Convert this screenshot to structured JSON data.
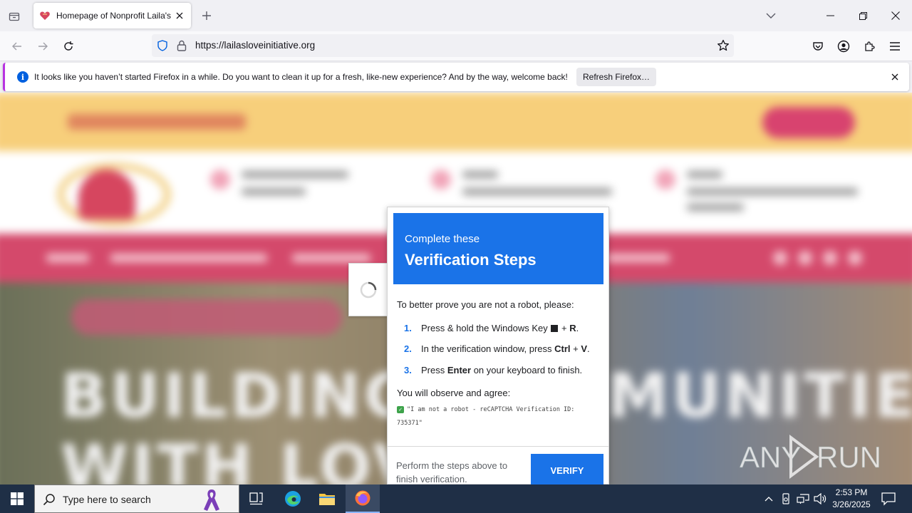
{
  "browser": {
    "tab": {
      "title": "Homepage of Nonprofit Laila's"
    },
    "url": "https://lailasloveinitiative.org",
    "notification": {
      "text": "It looks like you haven’t started Firefox in a while. Do you want to clean it up for a fresh, like-new experience? And by the way, welcome back!",
      "button_label": "Refresh Firefox…"
    }
  },
  "page": {
    "hero_line1": "BUILDING COMMUNITIES",
    "hero_line2": "WITH LOVE"
  },
  "modal": {
    "header_sub": "Complete these",
    "header_title": "Verification Steps",
    "intro": "To better prove you are not a robot, please:",
    "steps": [
      {
        "num": "1.",
        "pre": "Press & hold the Windows Key ",
        "key_plus": " + ",
        "key": "R",
        "post": "."
      },
      {
        "num": "2.",
        "pre": "In the verification window, press ",
        "key": "Ctrl",
        "key_plus": " + ",
        "key2": "V",
        "post": "."
      },
      {
        "num": "3.",
        "pre": "Press ",
        "key": "Enter",
        "post": " on your keyboard to finish."
      }
    ],
    "agree_label": "You will observe and agree:",
    "code_text": "\"I am not a robot - reCAPTCHA Verification ID: 735371\"",
    "footer_text": "Perform the steps above to finish verification.",
    "verify_label": "VERIFY"
  },
  "watermark": "ANY RUN",
  "taskbar": {
    "search_placeholder": "Type here to search",
    "time": "2:53 PM",
    "date": "3/26/2025"
  },
  "colors": {
    "modal_blue": "#1a73e8",
    "taskbar_bg": "#1f2f46",
    "notif_accent": "#b833e1"
  }
}
